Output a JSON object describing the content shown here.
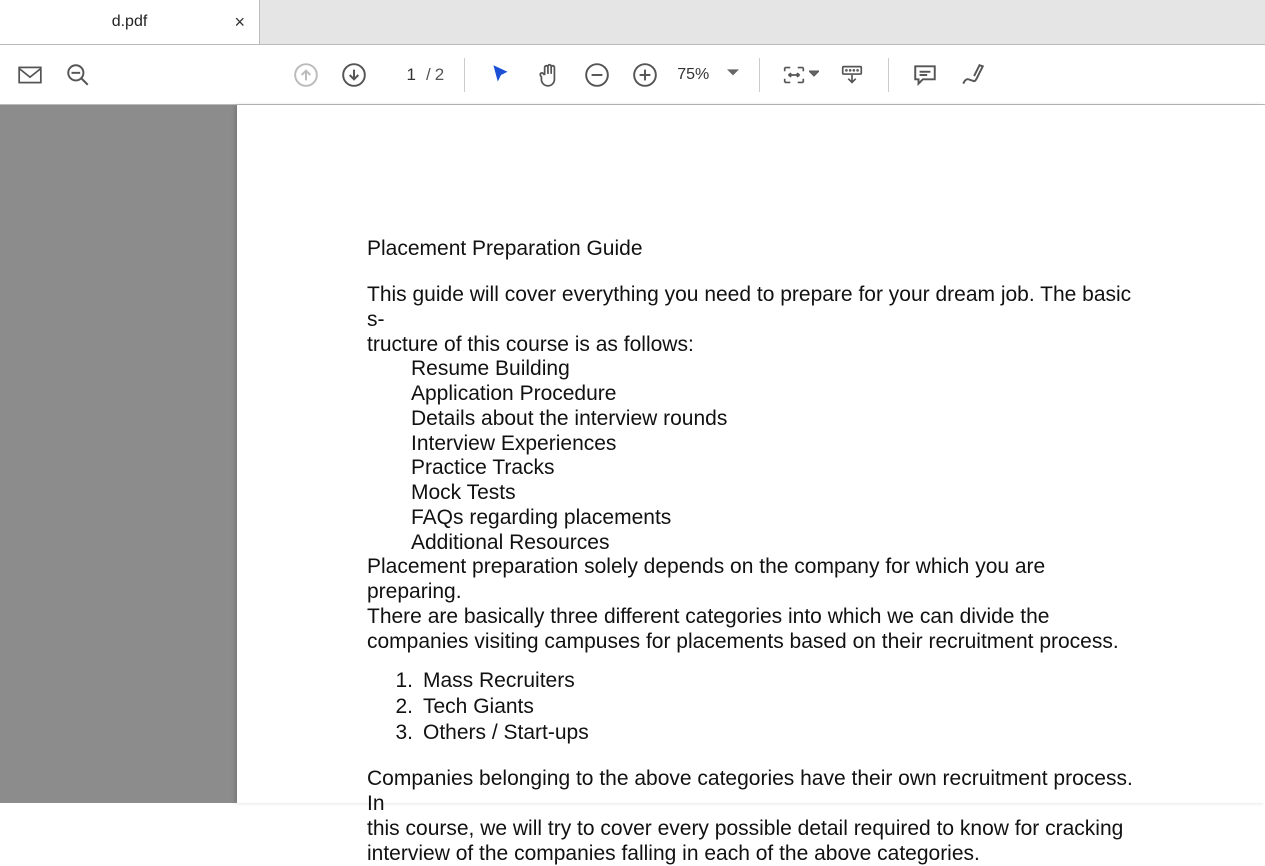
{
  "tab": {
    "filename": "d.pdf"
  },
  "toolbar": {
    "page_current": "1",
    "page_total": "2",
    "zoom": "75%"
  },
  "document": {
    "title": "Placement Preparation Guide",
    "intro_line1": "This guide will cover everything you need to prepare for your dream job. The basic s-",
    "intro_line2": "tructure of this course is as follows:",
    "bullets": [
      "Resume Building",
      "Application Procedure",
      "Details about the interview rounds",
      "Interview Experiences",
      "Practice Tracks",
      "Mock Tests",
      "FAQs regarding placements",
      "Additional Resources"
    ],
    "para2_l1": "Placement preparation solely depends on the company for which you are preparing.",
    "para2_l2": "There are basically three different categories into which we can divide the",
    "para2_l3": "companies visiting campuses for placements based on their recruitment process.",
    "numbered": [
      "Mass Recruiters",
      "Tech Giants",
      "Others / Start-ups"
    ],
    "para3_l1": "Companies belonging to the above categories have their own recruitment process. In",
    "para3_l2": "this course, we will try to cover every possible detail required to know for cracking",
    "para3_l3": "interview of the companies falling in each of the above categories."
  }
}
